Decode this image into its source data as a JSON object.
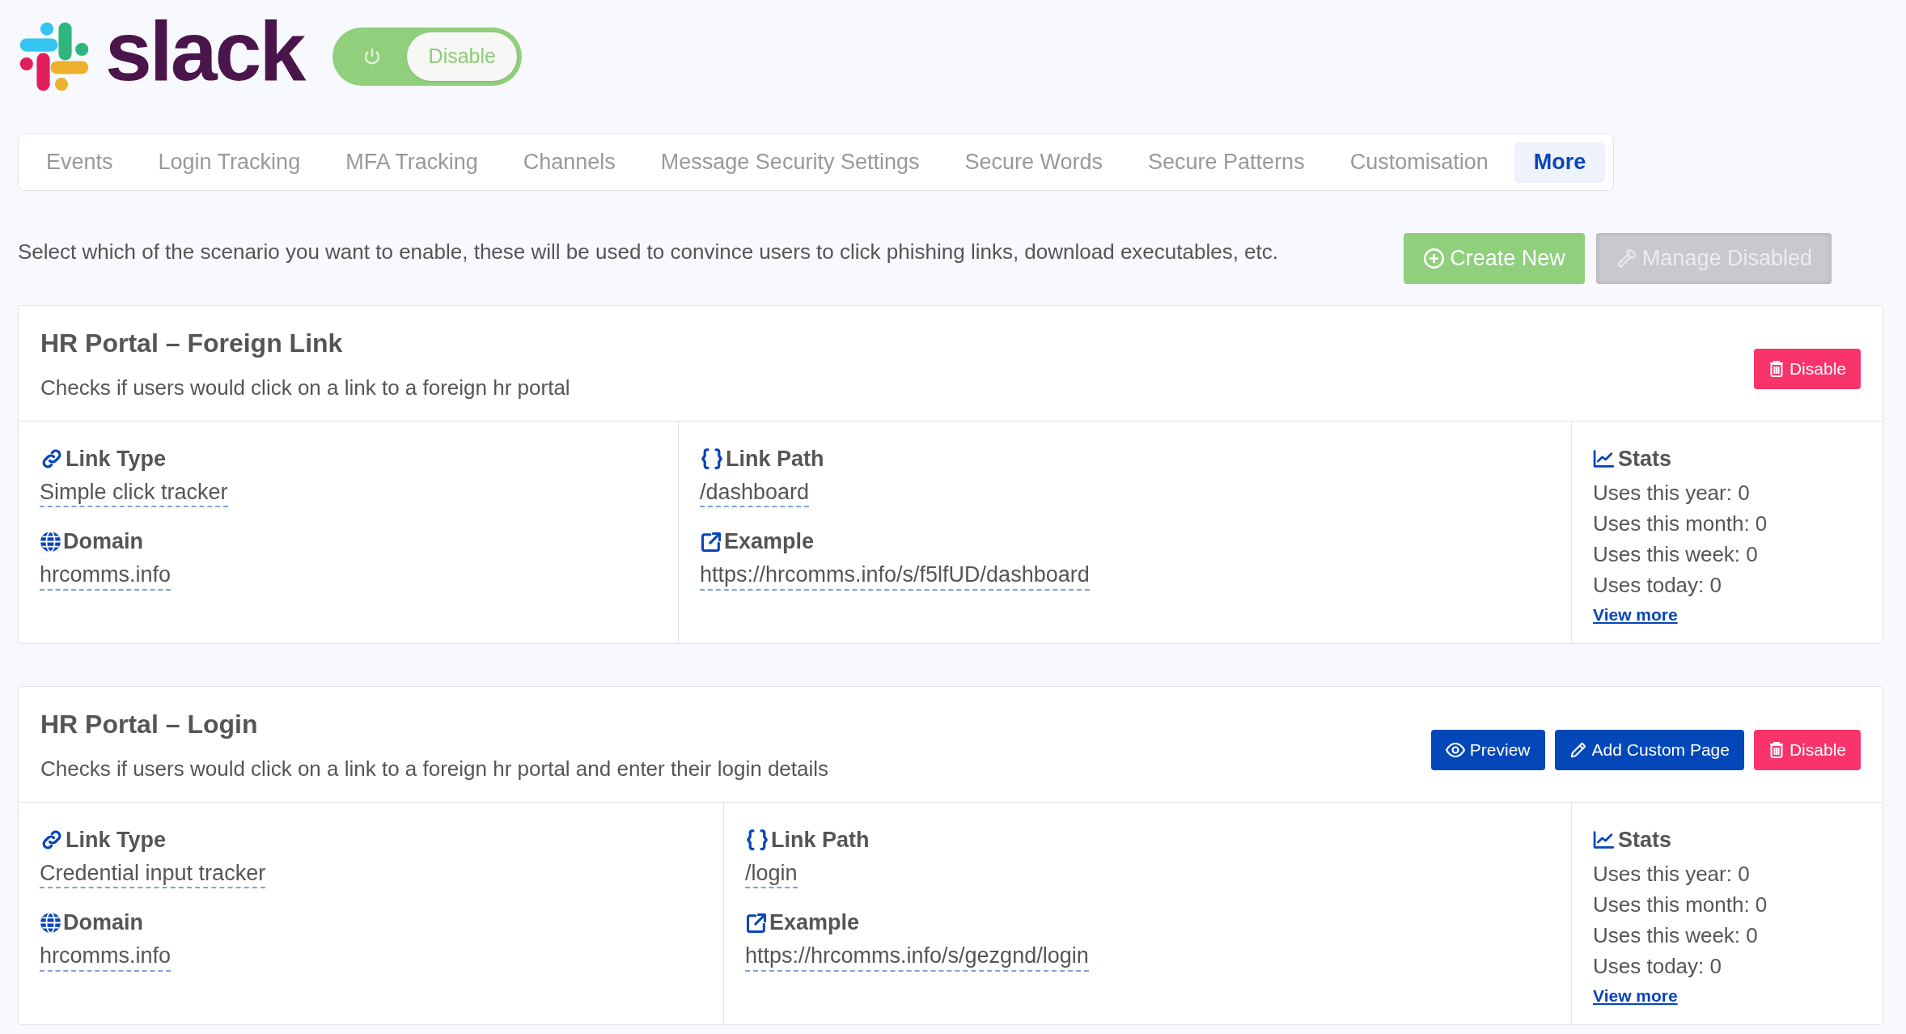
{
  "brand": {
    "name": "slack"
  },
  "toggle": {
    "label": "Disable",
    "on": true
  },
  "tabs": [
    {
      "label": "Events",
      "selected": false
    },
    {
      "label": "Login Tracking",
      "selected": false
    },
    {
      "label": "MFA Tracking",
      "selected": false
    },
    {
      "label": "Channels",
      "selected": false
    },
    {
      "label": "Message Security Settings",
      "selected": false
    },
    {
      "label": "Secure Words",
      "selected": false
    },
    {
      "label": "Secure Patterns",
      "selected": false
    },
    {
      "label": "Customisation",
      "selected": false
    },
    {
      "label": "More",
      "selected": true
    }
  ],
  "intro": "Select which of the scenario you want to enable, these will be used to convince users to click phishing links, download executables, etc.",
  "toolbar": [
    {
      "kind": "create",
      "label": "Create New",
      "disabled": false
    },
    {
      "kind": "manage",
      "label": "Manage Disabled",
      "disabled": true
    }
  ],
  "cards": [
    {
      "title": "HR Portal – Foreign Link",
      "description": "Checks if users would click on a link to a foreign hr portal",
      "actions": [
        {
          "kind": "disable",
          "label": "Disable"
        }
      ],
      "columns": [
        [
          {
            "kind": "link",
            "label": "Link Type",
            "value": "Simple click tracker"
          },
          {
            "kind": "globe",
            "label": "Domain",
            "value": "hrcomms.info"
          }
        ],
        [
          {
            "kind": "braces",
            "label": "Link Path",
            "value": "/dashboard"
          },
          {
            "kind": "external",
            "label": "Example",
            "value": "https://hrcomms.info/s/f5lfUD/dashboard"
          }
        ]
      ],
      "stats": {
        "title": "Stats",
        "lines": [
          "Uses this year: 0",
          "Uses this month: 0",
          "Uses this week: 0",
          "Uses today: 0"
        ],
        "link": "View more"
      }
    },
    {
      "title": "HR Portal – Login",
      "description": "Checks if users would click on a link to a foreign hr portal and enter their login details",
      "actions": [
        {
          "kind": "preview",
          "label": "Preview"
        },
        {
          "kind": "custom",
          "label": "Add Custom Page"
        },
        {
          "kind": "disable",
          "label": "Disable"
        }
      ],
      "columns": [
        [
          {
            "kind": "link",
            "label": "Link Type",
            "value": "Credential input tracker"
          },
          {
            "kind": "globe",
            "label": "Domain",
            "value": "hrcomms.info"
          }
        ],
        [
          {
            "kind": "braces",
            "label": "Link Path",
            "value": "/login"
          },
          {
            "kind": "external",
            "label": "Example",
            "value": "https://hrcomms.info/s/gezgnd/login"
          }
        ]
      ],
      "stats": {
        "title": "Stats",
        "lines": [
          "Uses this year: 0",
          "Uses this month: 0",
          "Uses this week: 0",
          "Uses today: 0"
        ],
        "link": "View more"
      }
    }
  ]
}
